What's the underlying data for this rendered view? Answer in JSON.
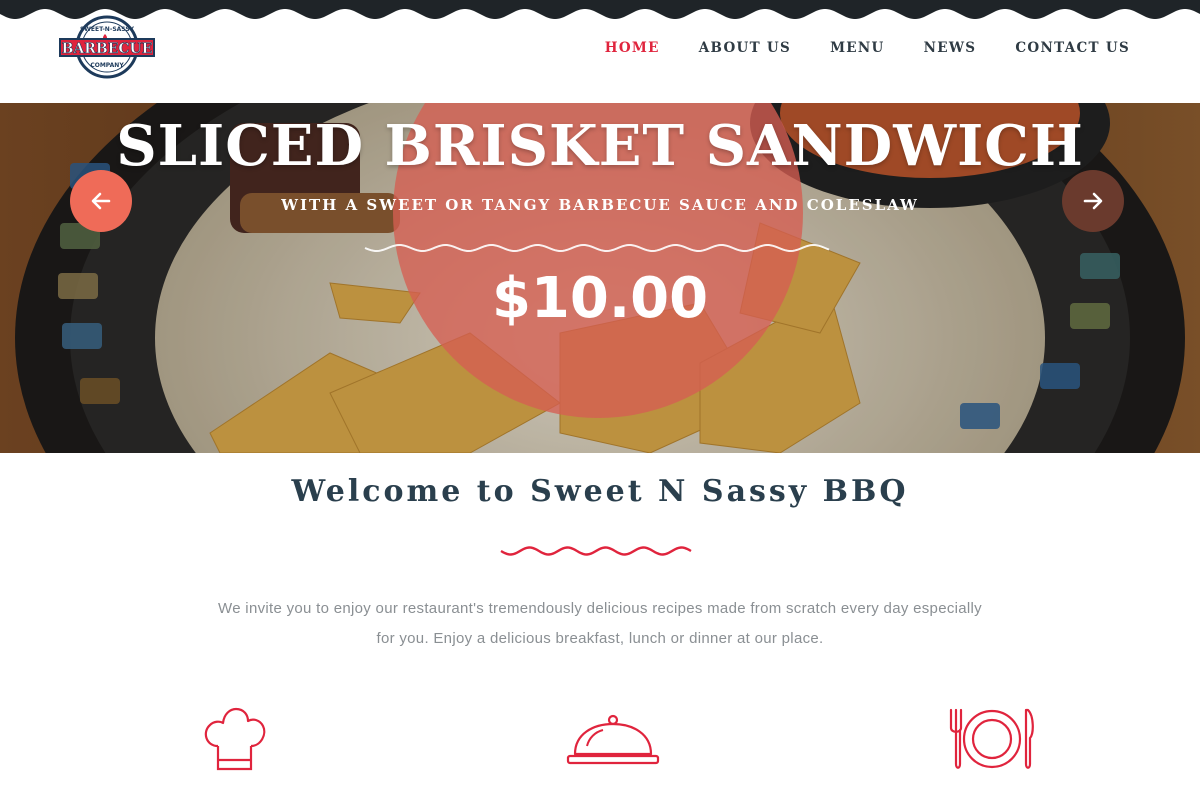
{
  "brand": {
    "logo_top_text": "SWEET-N-SASSY",
    "logo_main_text": "BARBECUE",
    "logo_bottom_text": "COMPANY"
  },
  "nav": {
    "items": [
      {
        "label": "HOME",
        "active": true
      },
      {
        "label": "ABOUT US",
        "active": false
      },
      {
        "label": "MENU",
        "active": false
      },
      {
        "label": "NEWS",
        "active": false
      },
      {
        "label": "CONTACT US",
        "active": false
      }
    ]
  },
  "hero": {
    "title": "SLICED BRISKET SANDWICH",
    "subtitle": "WITH A SWEET OR TANGY BARBECUE SAUCE AND COLESLAW",
    "price": "$10.00",
    "prev_icon": "arrow-left-icon",
    "next_icon": "arrow-right-icon"
  },
  "welcome": {
    "title": "Welcome to Sweet N Sassy BBQ",
    "intro_line1": "We invite you to enjoy our restaurant's tremendously delicious recipes made from scratch every day especially",
    "intro_line2": "for you. Enjoy a delicious breakfast, lunch or dinner at our place."
  },
  "features": {
    "icons": [
      "chef-hat-icon",
      "cloche-icon",
      "plate-cutlery-icon"
    ]
  },
  "colors": {
    "accent": "#e0243d",
    "nav_text": "#2f3b44",
    "heading": "#2a3f4d",
    "body_text": "#8a8f93",
    "top_strip": "#1f2428",
    "arrow_left": "#ef6b58",
    "arrow_right": "#6a3a2d"
  }
}
